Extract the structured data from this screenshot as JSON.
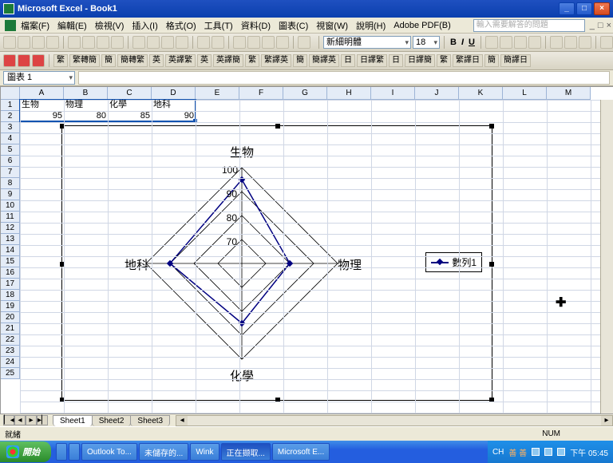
{
  "titlebar": {
    "title": "Microsoft Excel - Book1"
  },
  "menu": {
    "items": [
      "檔案(F)",
      "編輯(E)",
      "檢視(V)",
      "插入(I)",
      "格式(O)",
      "工具(T)",
      "資料(D)",
      "圖表(C)",
      "視窗(W)",
      "說明(H)",
      "Adobe PDF(B)"
    ],
    "help_placeholder": "輸入需要解答的問題"
  },
  "toolbar2": {
    "font": "新細明體",
    "size": "18",
    "bold": "B",
    "italic": "I",
    "underline": "U"
  },
  "lang_buttons": [
    "繁",
    "繁轉簡",
    "簡",
    "簡轉繁",
    "英",
    "英譯繁",
    "英",
    "英譯簡",
    "繁",
    "繁譯英",
    "簡",
    "簡譯英",
    "日",
    "日譯繁",
    "日",
    "日譯簡",
    "繁",
    "繁譯日",
    "簡",
    "簡譯日"
  ],
  "name_box": "圖表 1",
  "columns": [
    "A",
    "B",
    "C",
    "D",
    "E",
    "F",
    "G",
    "H",
    "I",
    "J",
    "K",
    "L",
    "M"
  ],
  "rows_visible": 25,
  "cell_data": {
    "headers": [
      "生物",
      "物理",
      "化學",
      "地科"
    ],
    "values": [
      95,
      80,
      85,
      90
    ]
  },
  "chart_data": {
    "type": "radar",
    "title": "",
    "axes": [
      "生物",
      "物理",
      "化學",
      "地科"
    ],
    "ticks": [
      70,
      80,
      90,
      100
    ],
    "axis_range": [
      60,
      100
    ],
    "series": [
      {
        "name": "數列1",
        "values": [
          95,
          80,
          85,
          90
        ],
        "color": "#000080"
      }
    ]
  },
  "sheet_tabs": [
    "Sheet1",
    "Sheet2",
    "Sheet3"
  ],
  "status": {
    "left": "就緒",
    "num": "NUM"
  },
  "taskbar": {
    "start": "開始",
    "tasks": [
      "",
      "",
      "Outlook To...",
      "未儲存的...",
      "Wink",
      "正在撷取...",
      "Microsoft E..."
    ],
    "tray_lang": "CH",
    "tray_ime": "善 善",
    "clock": "下午 05:45"
  }
}
